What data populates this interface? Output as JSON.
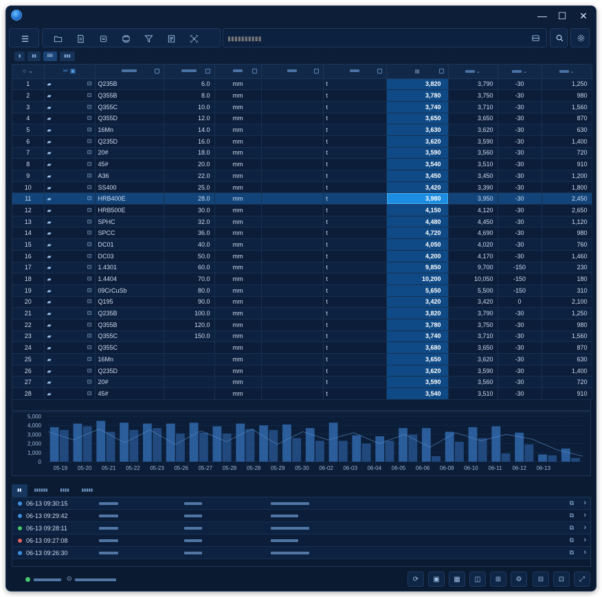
{
  "window": {
    "minimize": "—",
    "maximize": "☐",
    "close": "✕"
  },
  "toolbar": {
    "search_placeholder": "▮▮▮▮▮▮▮▮▮▮"
  },
  "view_tabs": [
    "▮",
    "▮▮",
    "BB",
    "▮▮▮"
  ],
  "columns": [
    "",
    "",
    "▮▮▮",
    "▮▮▮",
    "▮▮",
    "▮▮",
    "▮▮",
    "▮▮",
    "▮▮",
    "▮▮",
    "▮▮"
  ],
  "rows": [
    [
      "1",
      "Q235B",
      "6.0",
      "mm",
      "t",
      "3,820",
      "3,790",
      "-30",
      "1,250"
    ],
    [
      "2",
      "Q355B",
      "8.0",
      "mm",
      "t",
      "3,780",
      "3,750",
      "-30",
      "980"
    ],
    [
      "3",
      "Q355C",
      "10.0",
      "mm",
      "t",
      "3,740",
      "3,710",
      "-30",
      "1,560"
    ],
    [
      "4",
      "Q355D",
      "12.0",
      "mm",
      "t",
      "3,650",
      "3,650",
      "-30",
      "870"
    ],
    [
      "5",
      "16Mn",
      "14.0",
      "mm",
      "t",
      "3,630",
      "3,620",
      "-30",
      "630"
    ],
    [
      "6",
      "Q235D",
      "16.0",
      "mm",
      "t",
      "3,620",
      "3,590",
      "-30",
      "1,400"
    ],
    [
      "7",
      "20#",
      "18.0",
      "mm",
      "t",
      "3,590",
      "3,560",
      "-30",
      "720"
    ],
    [
      "8",
      "45#",
      "20.0",
      "mm",
      "t",
      "3,540",
      "3,510",
      "-30",
      "910"
    ],
    [
      "9",
      "A36",
      "22.0",
      "mm",
      "t",
      "3,450",
      "3,450",
      "-30",
      "1,200"
    ],
    [
      "10",
      "SS400",
      "25.0",
      "mm",
      "t",
      "3,420",
      "3,390",
      "-30",
      "1,800"
    ],
    [
      "11",
      "HRB400E",
      "28.0",
      "mm",
      "t",
      "3,980",
      "3,950",
      "-30",
      "2,450"
    ],
    [
      "12",
      "HRB500E",
      "30.0",
      "mm",
      "t",
      "4,150",
      "4,120",
      "-30",
      "2,650"
    ],
    [
      "13",
      "SPHC",
      "32.0",
      "mm",
      "t",
      "4,480",
      "4,450",
      "-30",
      "1,120"
    ],
    [
      "14",
      "SPCC",
      "36.0",
      "mm",
      "t",
      "4,720",
      "4,690",
      "-30",
      "980"
    ],
    [
      "15",
      "DC01",
      "40.0",
      "mm",
      "t",
      "4,050",
      "4,020",
      "-30",
      "760"
    ],
    [
      "16",
      "DC03",
      "50.0",
      "mm",
      "t",
      "4,200",
      "4,170",
      "-30",
      "1,460"
    ],
    [
      "17",
      "1.4301",
      "60.0",
      "mm",
      "t",
      "9,850",
      "9,700",
      "-150",
      "230"
    ],
    [
      "18",
      "1.4404",
      "70.0",
      "mm",
      "t",
      "10,200",
      "10,050",
      "-150",
      "180"
    ],
    [
      "19",
      "09CrCuSb",
      "80.0",
      "mm",
      "t",
      "5,650",
      "5,500",
      "-150",
      "310"
    ],
    [
      "20",
      "Q195",
      "90.0",
      "mm",
      "t",
      "3,420",
      "3,420",
      "0",
      "2,100"
    ],
    [
      "21",
      "Q235B",
      "100.0",
      "mm",
      "t",
      "3,820",
      "3,790",
      "-30",
      "1,250"
    ],
    [
      "22",
      "Q355B",
      "120.0",
      "mm",
      "t",
      "3,780",
      "3,750",
      "-30",
      "980"
    ],
    [
      "23",
      "Q355C",
      "150.0",
      "mm",
      "t",
      "3,740",
      "3,710",
      "-30",
      "1,560"
    ],
    [
      "24",
      "Q355C",
      "",
      "mm",
      "t",
      "3,680",
      "3,650",
      "-30",
      "870"
    ],
    [
      "25",
      "16Mn",
      "",
      "mm",
      "t",
      "3,650",
      "3,620",
      "-30",
      "630"
    ],
    [
      "26",
      "Q235D",
      "",
      "mm",
      "t",
      "3,620",
      "3,590",
      "-30",
      "1,400"
    ],
    [
      "27",
      "20#",
      "",
      "mm",
      "t",
      "3,590",
      "3,560",
      "-30",
      "720"
    ],
    [
      "28",
      "45#",
      "",
      "mm",
      "t",
      "3,540",
      "3,510",
      "-30",
      "910"
    ]
  ],
  "selected_row": "11",
  "chart_data": {
    "type": "bar",
    "categories": [
      "05-19",
      "05-20",
      "05-21",
      "05-22",
      "05-23",
      "05-26",
      "05-27",
      "05-28",
      "05-28",
      "05-29",
      "05-30",
      "06-02",
      "06-03",
      "06-04",
      "06-05",
      "06-06",
      "06-09",
      "06-10",
      "06-11",
      "06-12",
      "06-13"
    ],
    "y_ticks": [
      "5,000",
      "4,000",
      "3,000",
      "2,000",
      "1,000",
      "0"
    ],
    "ylim": [
      0,
      5000
    ],
    "series": [
      {
        "values": [
          3800,
          4200,
          4500,
          4300,
          4200,
          4200,
          4300,
          3900,
          4200,
          4000,
          4100,
          3700,
          4300,
          2900,
          2800,
          3700,
          3700,
          3300,
          3800,
          3900,
          3200,
          800,
          1450
        ]
      },
      {
        "values": [
          3500,
          3900,
          3300,
          3500,
          3700,
          3100,
          3200,
          3100,
          3600,
          3500,
          2600,
          2300,
          2300,
          2000,
          2300,
          3000,
          600,
          2200,
          2600,
          900,
          1900,
          700,
          400
        ]
      }
    ],
    "line": [
      3300,
      2400,
      3600,
      2100,
      3500,
      1900,
      3400,
      2200,
      3600,
      1900,
      3300,
      2400,
      3200,
      2000,
      3000,
      1600,
      3200,
      2300,
      3000,
      2500,
      1300,
      600
    ]
  },
  "log": {
    "tabs": [
      "▮▮",
      "▮▮▮▮▮▮",
      "▮▮▮▮",
      "▮▮▮▮▮"
    ],
    "rows": [
      {
        "time": "06-13 09:30:15",
        "color": "#3f8fe0"
      },
      {
        "time": "06-13 09:29:42",
        "color": "#3f8fe0"
      },
      {
        "time": "06-13 09:28:11",
        "color": "#49c76a"
      },
      {
        "time": "06-13 09:27:08",
        "color": "#e0625c"
      },
      {
        "time": "06-13 09:26:30",
        "color": "#3f8fe0"
      }
    ]
  },
  "status": {
    "indicator_color": "#49c76a"
  }
}
